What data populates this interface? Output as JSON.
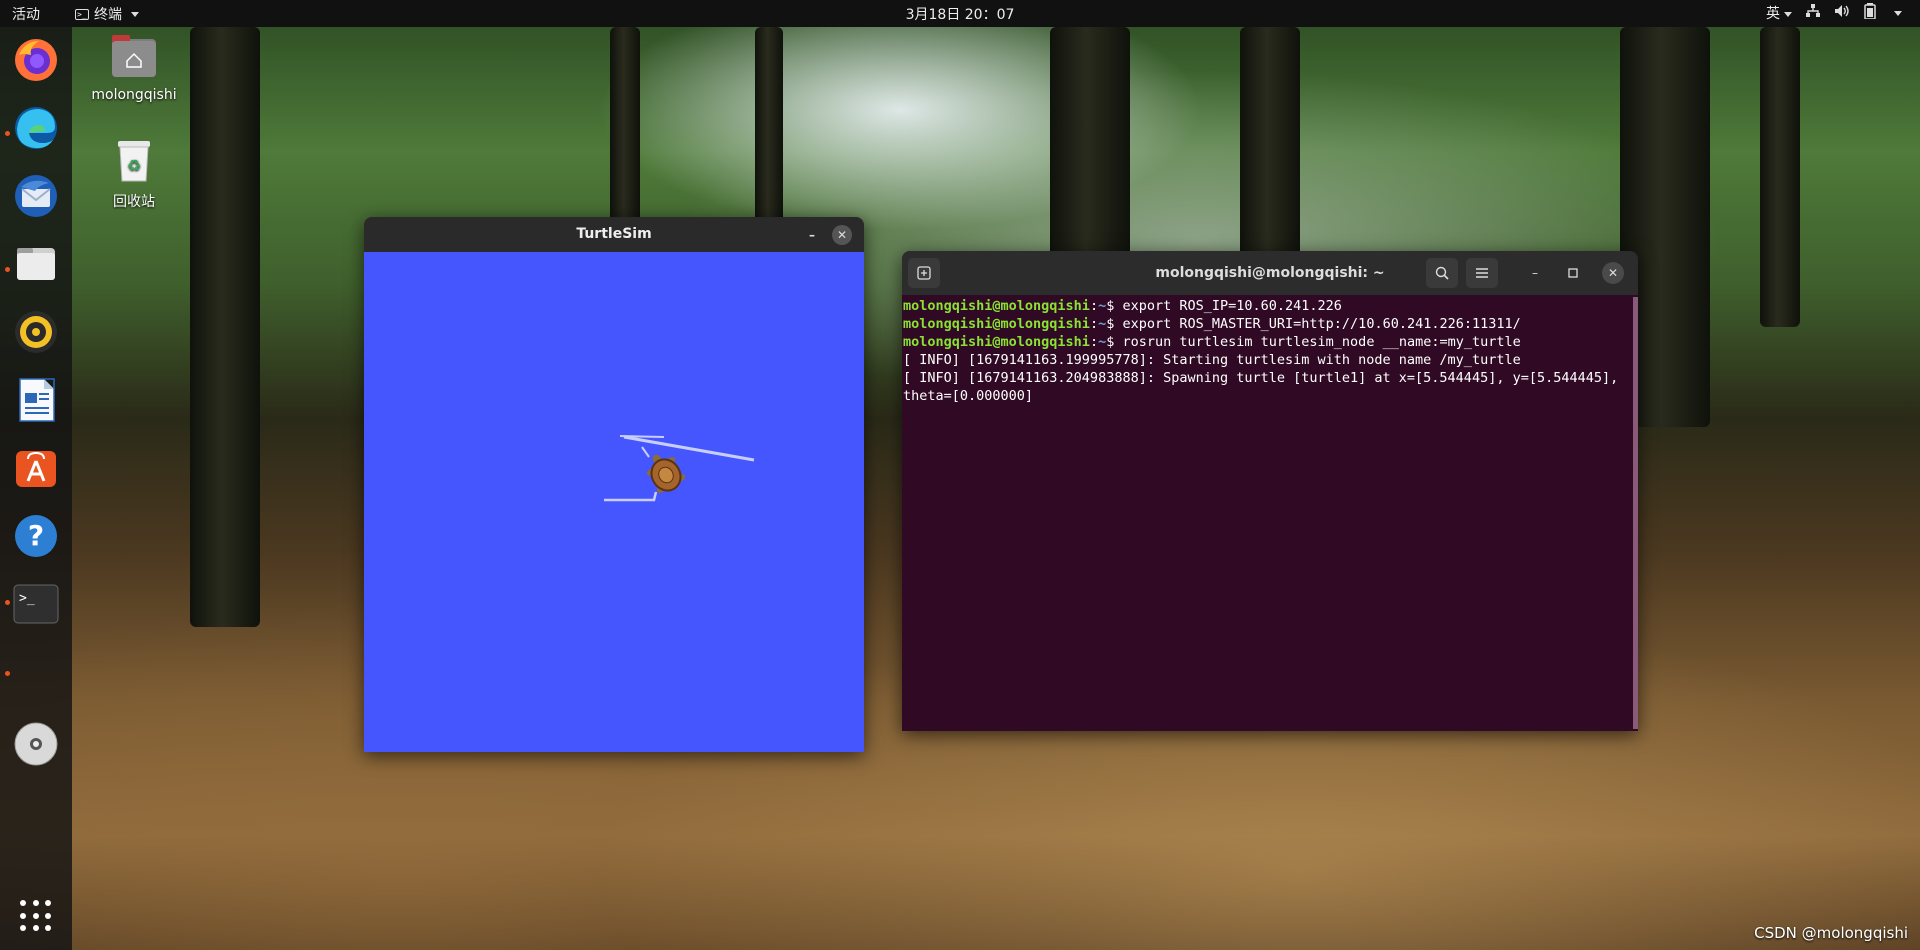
{
  "topbar": {
    "activities": "活动",
    "app_menu": "终端",
    "clock": "3月18日  20：07",
    "input_method": "英"
  },
  "dock": {
    "items": [
      {
        "icon": "firefox-icon"
      },
      {
        "icon": "edge-icon"
      },
      {
        "icon": "thunderbird-icon"
      },
      {
        "icon": "files-icon"
      },
      {
        "icon": "rhythmbox-icon"
      },
      {
        "icon": "libreoffice-writer-icon"
      },
      {
        "icon": "app-center-icon"
      },
      {
        "icon": "help-icon"
      },
      {
        "icon": "terminal-icon"
      },
      {
        "icon": "dvd-icon"
      },
      {
        "icon": "show-apps-icon"
      }
    ]
  },
  "desktop": {
    "icons": [
      {
        "label": "molongqishi",
        "icon": "home-folder-icon"
      },
      {
        "label": "回收站",
        "icon": "trash-icon"
      }
    ]
  },
  "turtlesim": {
    "title": "TurtleSim",
    "background": "#4556ff"
  },
  "terminal": {
    "title": "molongqishi@molongqishi: ~",
    "lines": [
      {
        "user": "molongqishi@molongqishi",
        "path": "~",
        "cmd": "export ROS_IP=10.60.241.226"
      },
      {
        "user": "molongqishi@molongqishi",
        "path": "~",
        "cmd": "export ROS_MASTER_URI=http://10.60.241.226:11311/"
      },
      {
        "user": "molongqishi@molongqishi",
        "path": "~",
        "cmd": "rosrun turtlesim turtlesim_node __name:=my_turtle"
      }
    ],
    "output": [
      "[ INFO] [1679141163.199995778]: Starting turtlesim with node name /my_turtle",
      "[ INFO] [1679141163.204983888]: Spawning turtle [turtle1] at x=[5.544445], y=[5.544445], theta=[0.000000]"
    ]
  },
  "watermark": "CSDN @molongqishi",
  "colors": {
    "terminal_bg": "#300a24",
    "prompt_user": "#8ae234",
    "prompt_path": "#729fcf",
    "accent": "#e95420"
  }
}
